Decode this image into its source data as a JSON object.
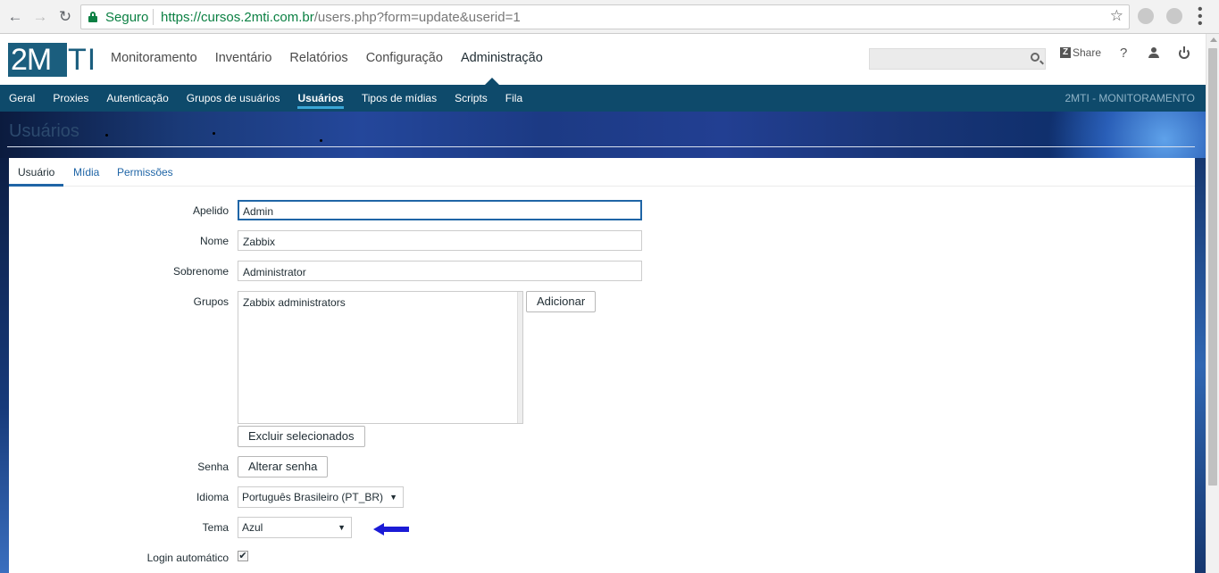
{
  "browser": {
    "secure_label": "Seguro",
    "url_host": "https://cursos.2mti.com.br",
    "url_path": "/users.php?form=update&userid=1"
  },
  "header": {
    "logo_box": "2M",
    "logo_ti": "TI",
    "menu": [
      "Monitoramento",
      "Inventário",
      "Relatórios",
      "Configuração",
      "Administração"
    ],
    "active_menu": "Administração",
    "search_placeholder": "",
    "share_label": "Share",
    "help_label": "?"
  },
  "submenu": {
    "items": [
      "Geral",
      "Proxies",
      "Autenticação",
      "Grupos de usuários",
      "Usuários",
      "Tipos de mídias",
      "Scripts",
      "Fila"
    ],
    "active": "Usuários",
    "brand": "2MTI - MONITORAMENTO"
  },
  "page": {
    "title": "Usuários"
  },
  "tabs": {
    "items": [
      "Usuário",
      "Mídia",
      "Permissões"
    ],
    "active": "Usuário"
  },
  "form": {
    "alias": {
      "label": "Apelido",
      "value": "Admin"
    },
    "name": {
      "label": "Nome",
      "value": "Zabbix"
    },
    "surname": {
      "label": "Sobrenome",
      "value": "Administrator"
    },
    "groups": {
      "label": "Grupos",
      "items": [
        "Zabbix administrators"
      ],
      "add_button": "Adicionar",
      "remove_button": "Excluir selecionados"
    },
    "password": {
      "label": "Senha",
      "button": "Alterar senha"
    },
    "language": {
      "label": "Idioma",
      "value": "Português Brasileiro (PT_BR)"
    },
    "theme": {
      "label": "Tema",
      "value": "Azul"
    },
    "autologin": {
      "label": "Login automático",
      "checked": true
    }
  },
  "colors": {
    "brand": "#1b5e7e",
    "submenu_bg": "#0e4a6b",
    "link": "#1f65a6",
    "annotation_arrow": "#1b1bd6"
  }
}
